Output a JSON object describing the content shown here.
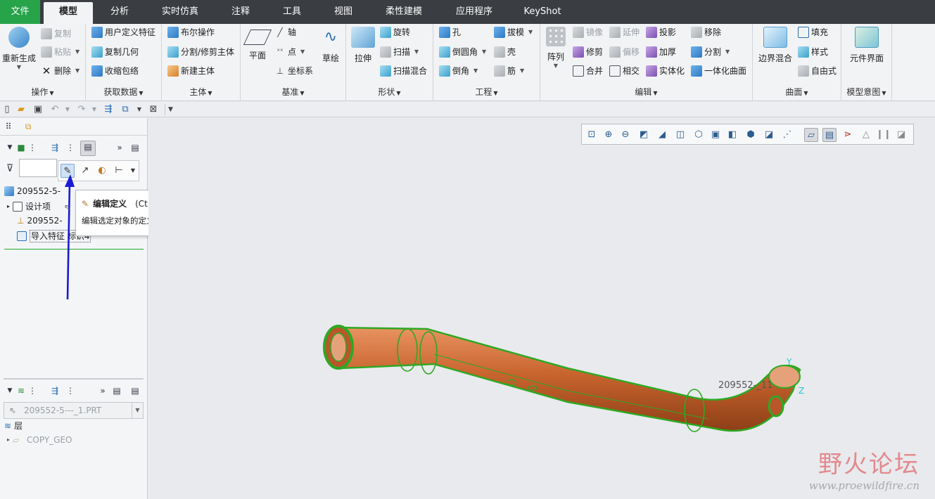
{
  "ribbon_tabs": [
    "文件",
    "模型",
    "分析",
    "实时仿真",
    "注释",
    "工具",
    "视图",
    "柔性建模",
    "应用程序",
    "KeyShot"
  ],
  "groups": {
    "operations": {
      "label": "操作",
      "regenerate": "重新生成",
      "copy": "复制",
      "paste": "粘贴",
      "delete": "删除"
    },
    "get_data": {
      "label": "获取数据",
      "user_defined_feature": "用户定义特征",
      "copy_geometry": "复制几何",
      "shrinkwrap": "收缩包络"
    },
    "body": {
      "label": "主体",
      "boolean": "布尔操作",
      "split_trim_body": "分割/修剪主体",
      "new_body": "新建主体"
    },
    "datum": {
      "label": "基准",
      "plane": "平面",
      "axis": "轴",
      "point": "点",
      "csys": "坐标系",
      "sketch": "草绘"
    },
    "shapes": {
      "label": "形状",
      "extrude": "拉伸",
      "revolve": "旋转",
      "sweep": "扫描",
      "swept_blend": "扫描混合"
    },
    "engineering": {
      "label": "工程",
      "hole": "孔",
      "round": "倒圆角",
      "chamfer": "倒角",
      "draft": "拔模",
      "shell": "壳",
      "rib": "筋"
    },
    "editing": {
      "label": "编辑",
      "pattern": "阵列",
      "mirror": "镜像",
      "trim": "修剪",
      "merge": "合并",
      "extend": "延伸",
      "offset": "偏移",
      "intersect": "相交",
      "project": "投影",
      "thicken": "加厚",
      "solidify": "实体化",
      "remove": "移除",
      "split": "分割",
      "unify_surface": "一体化曲面"
    },
    "surfaces": {
      "label": "曲面",
      "boundary_blend": "边界混合",
      "fill": "填充",
      "style": "样式",
      "freestyle": "自由式"
    },
    "model_intent": {
      "label": "模型意图",
      "component_interface": "元件界面"
    }
  },
  "model_tree": {
    "root": "209552-5-",
    "items": [
      "设计项",
      "209552-",
      "导入特征 标识4"
    ]
  },
  "tooltip": {
    "title": "编辑定义",
    "shortcut": "(Ctrl+E)",
    "description": "编辑选定对象的定义。"
  },
  "layer_panel": {
    "model_name": "209552-5---_1.PRT",
    "layers_label": "层",
    "layer_item": "COPY_GEO"
  },
  "graphics": {
    "part_label": "209552-_11",
    "axis_y": "Y",
    "axis_z": "Z"
  },
  "watermark": {
    "title": "野火论坛",
    "url": "www.proewildfire.cn"
  },
  "colors": {
    "file_tab": "#27a34a",
    "tab_bar": "#3a3d42",
    "pipe_fill": "#c8642e",
    "pipe_highlight": "#e89361",
    "edge_green": "#2fa824",
    "annotation_arrow": "#1a1ad6",
    "axis_cyan": "#29c3d6"
  }
}
